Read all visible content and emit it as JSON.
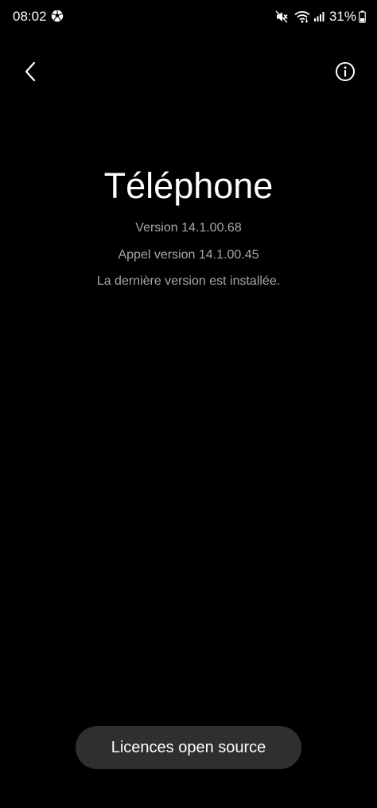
{
  "status_bar": {
    "time": "08:02",
    "battery_percent": "31%",
    "icons": [
      "soccer-ball-icon",
      "mute-icon",
      "wifi-icon",
      "signal-icon",
      "battery-icon"
    ]
  },
  "nav": {
    "back_icon": "chevron-left-icon",
    "info_icon": "info-circle-icon"
  },
  "app": {
    "title": "Téléphone",
    "version": "Version 14.1.00.68",
    "call_version": "Appel version 14.1.00.45",
    "update_status": "La dernière version est installée."
  },
  "footer": {
    "oss_button_label": "Licences open source"
  },
  "colors": {
    "background": "#000000",
    "text_primary": "#ffffff",
    "text_secondary": "#a7a7a7",
    "button_bg": "#2f2f2f"
  }
}
